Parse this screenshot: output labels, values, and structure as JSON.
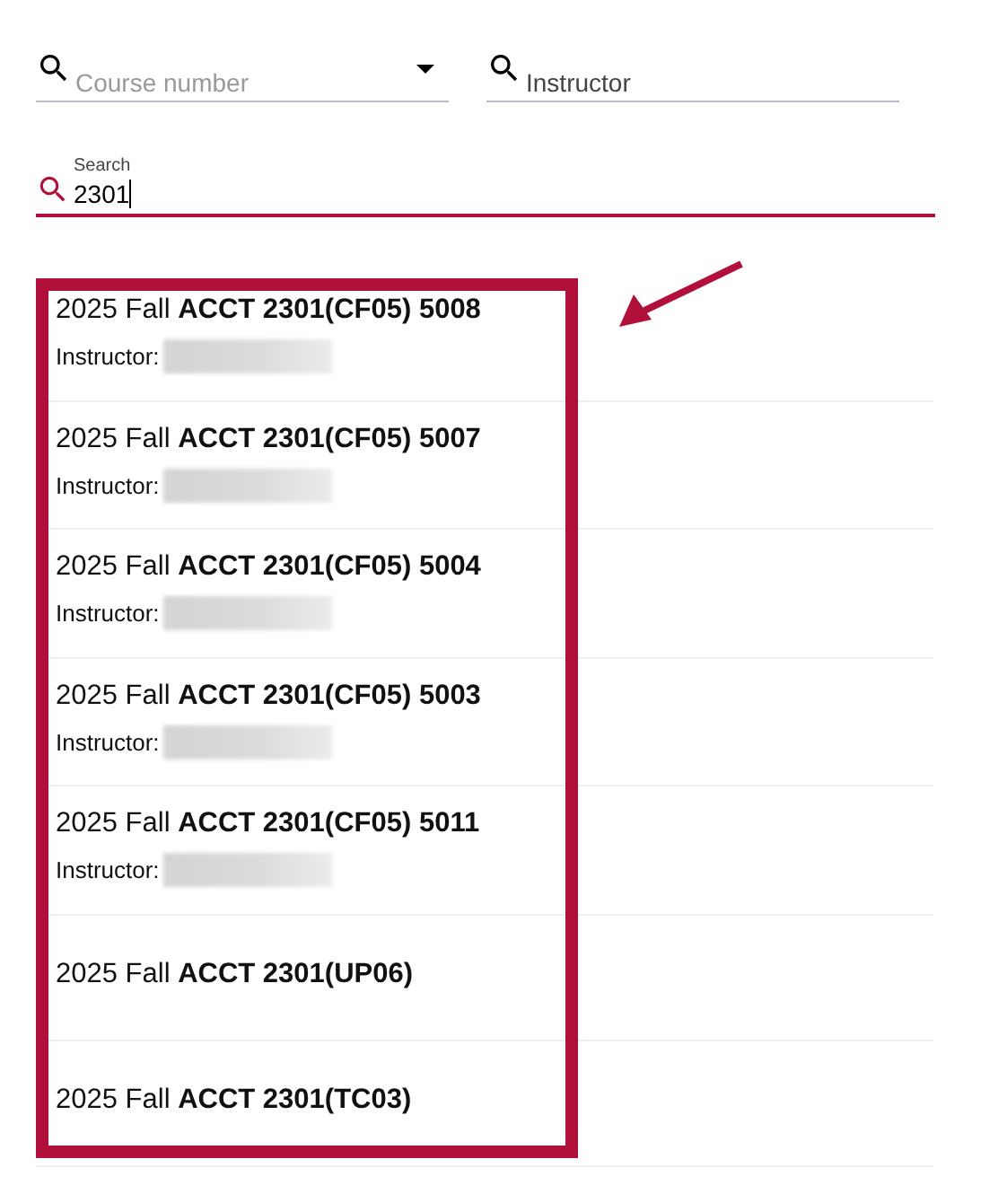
{
  "filters": [
    {
      "kind": "dropdown",
      "placeholder": "Course number"
    },
    {
      "kind": "text",
      "placeholder": "Instructor"
    }
  ],
  "search": {
    "label": "Search",
    "value": "2301"
  },
  "results": [
    {
      "title": "2025 Fall **ACCT 2301(CF05) 5008**",
      "instructor_label": "Instructor:",
      "instructor_redacted": true
    },
    {
      "title": "2025 Fall **ACCT 2301(CF05) 5007**",
      "instructor_label": "Instructor:",
      "instructor_redacted": true
    },
    {
      "title": "2025 Fall **ACCT 2301(CF05) 5004**",
      "instructor_label": "Instructor:",
      "instructor_redacted": true
    },
    {
      "title": "2025 Fall **ACCT 2301(CF05) 5003**",
      "instructor_label": "Instructor:",
      "instructor_redacted": true
    },
    {
      "title": "2025 Fall **ACCT 2301(CF05) 5011**",
      "instructor_label": "Instructor:",
      "instructor_redacted": true
    },
    {
      "title": "2025 Fall **ACCT 2301(UP06)**"
    },
    {
      "title": "2025 Fall **ACCT 2301(TC03)**"
    }
  ],
  "annotation": {
    "highlight": true,
    "arrow": true,
    "color": "#b0103a"
  }
}
